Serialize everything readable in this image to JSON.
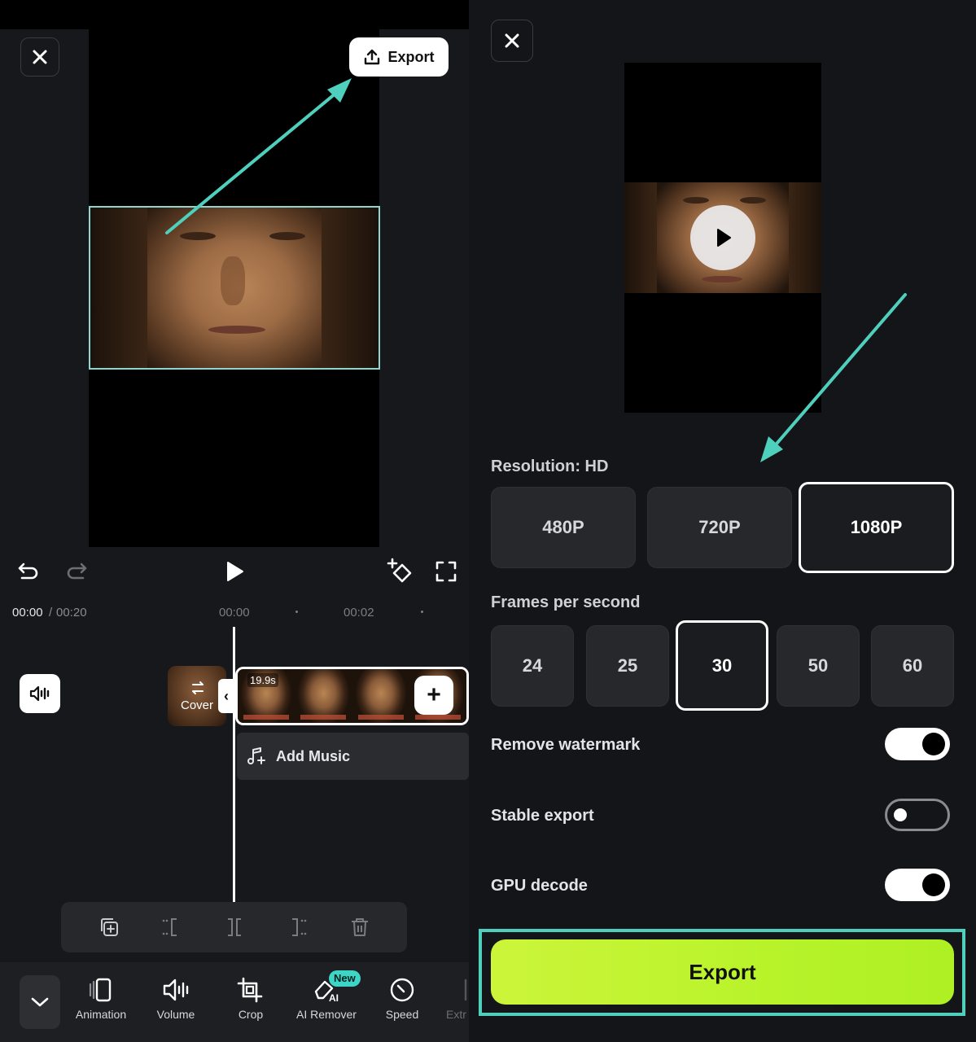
{
  "editor": {
    "export_label": "Export",
    "time_current": "00:00",
    "time_separator": "/",
    "time_total": "00:20",
    "ruler_ticks": [
      "00:00",
      "00:02"
    ],
    "cover_label": "Cover",
    "clip_duration": "19.9s",
    "add_music_label": "Add Music",
    "tools": [
      {
        "label": "Animation",
        "icon": "animation-icon"
      },
      {
        "label": "Volume",
        "icon": "volume-icon"
      },
      {
        "label": "Crop",
        "icon": "crop-icon"
      },
      {
        "label": "AI Remover",
        "icon": "ai-remover-icon"
      },
      {
        "label": "Speed",
        "icon": "speed-icon"
      },
      {
        "label": "Extr",
        "icon": "extract-icon"
      }
    ],
    "new_badge": "New"
  },
  "export_dialog": {
    "resolution_label": "Resolution: HD",
    "resolutions": [
      "480P",
      "720P",
      "1080P"
    ],
    "selected_resolution": "1080P",
    "fps_label": "Frames per second",
    "fps_options": [
      "24",
      "25",
      "30",
      "50",
      "60"
    ],
    "selected_fps": "30",
    "settings": [
      {
        "label": "Remove watermark",
        "on": true
      },
      {
        "label": "Stable export",
        "on": false
      },
      {
        "label": "GPU decode",
        "on": true
      }
    ],
    "export_button": "Export"
  },
  "colors": {
    "accent_green": "#b8f32a",
    "annotation_teal": "#4fd0bd",
    "panel_bg": "#17181b"
  }
}
